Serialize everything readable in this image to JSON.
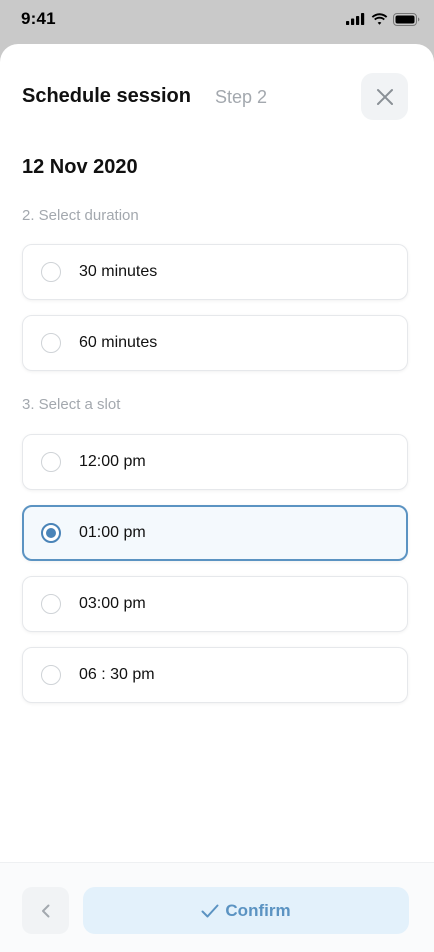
{
  "status_bar": {
    "time": "9:41"
  },
  "header": {
    "title": "Schedule session",
    "step": "Step 2"
  },
  "date": "12 Nov 2020",
  "duration": {
    "label": "2. Select duration",
    "options": [
      {
        "label": "30 minutes",
        "selected": false
      },
      {
        "label": "60 minutes",
        "selected": false
      }
    ]
  },
  "slot": {
    "label": "3. Select a slot",
    "options": [
      {
        "label": "12:00 pm",
        "selected": false
      },
      {
        "label": "01:00 pm",
        "selected": true
      },
      {
        "label": "03:00 pm",
        "selected": false
      },
      {
        "label": "06 : 30 pm",
        "selected": false
      }
    ]
  },
  "footer": {
    "confirm_label": "Confirm"
  },
  "colors": {
    "accent": "#4a84b8",
    "confirm_bg": "#e3f1fb",
    "muted": "#a3a8ae"
  }
}
